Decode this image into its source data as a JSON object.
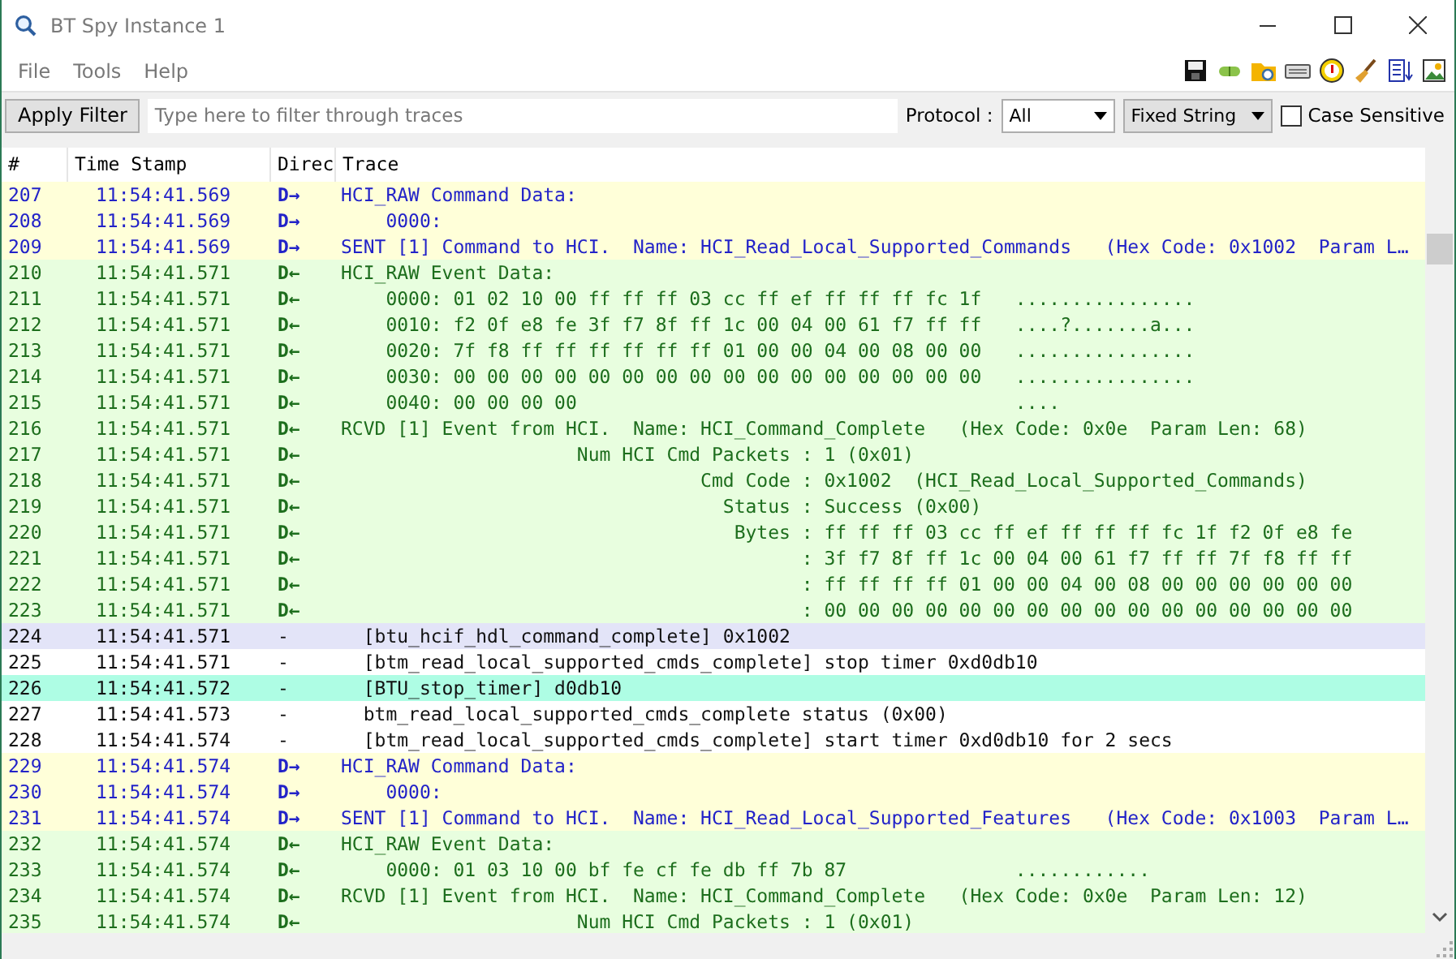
{
  "window": {
    "title": "BT Spy Instance 1"
  },
  "menu": [
    "File",
    "Tools",
    "Help"
  ],
  "filter": {
    "button": "Apply Filter",
    "placeholder": "Type here to filter through traces",
    "protocol_label": "Protocol :",
    "protocol": "All",
    "match_mode": "Fixed String",
    "case_sensitive": {
      "label": "Case Sensitive",
      "checked": false
    }
  },
  "columns": [
    "#",
    "Time Stamp",
    "Direc",
    "Trace"
  ],
  "rows": [
    {
      "kind": "sent",
      "color": "#ffffd9",
      "num": "207",
      "time": "11:54:41.569",
      "dir": "D→",
      "trace": "HCI_RAW Command Data:"
    },
    {
      "kind": "sent",
      "color": "#ffffd9",
      "num": "208",
      "time": "11:54:41.569",
      "dir": "D→",
      "trace": "    0000:"
    },
    {
      "kind": "sent",
      "color": "#ffffd9",
      "num": "209",
      "time": "11:54:41.569",
      "dir": "D→",
      "trace": "SENT [1] Command to HCI.  Name: HCI_Read_Local_Supported_Commands   (Hex Code: 0x1002  Param L…"
    },
    {
      "kind": "rcvd",
      "color": "#e8fedf",
      "num": "210",
      "time": "11:54:41.571",
      "dir": "D←",
      "trace": "HCI_RAW Event Data:"
    },
    {
      "kind": "rcvd",
      "color": "#e8fedf",
      "num": "211",
      "time": "11:54:41.571",
      "dir": "D←",
      "trace": "    0000: 01 02 10 00 ff ff ff 03 cc ff ef ff ff ff fc 1f   ................"
    },
    {
      "kind": "rcvd",
      "color": "#e8fedf",
      "num": "212",
      "time": "11:54:41.571",
      "dir": "D←",
      "trace": "    0010: f2 0f e8 fe 3f f7 8f ff 1c 00 04 00 61 f7 ff ff   ....?.......a..."
    },
    {
      "kind": "rcvd",
      "color": "#e8fedf",
      "num": "213",
      "time": "11:54:41.571",
      "dir": "D←",
      "trace": "    0020: 7f f8 ff ff ff ff ff ff 01 00 00 04 00 08 00 00   ................"
    },
    {
      "kind": "rcvd",
      "color": "#e8fedf",
      "num": "214",
      "time": "11:54:41.571",
      "dir": "D←",
      "trace": "    0030: 00 00 00 00 00 00 00 00 00 00 00 00 00 00 00 00   ................"
    },
    {
      "kind": "rcvd",
      "color": "#e8fedf",
      "num": "215",
      "time": "11:54:41.571",
      "dir": "D←",
      "trace": "    0040: 00 00 00 00                                       ...."
    },
    {
      "kind": "rcvd",
      "color": "#e8fedf",
      "num": "216",
      "time": "11:54:41.571",
      "dir": "D←",
      "trace": "RCVD [1] Event from HCI.  Name: HCI_Command_Complete   (Hex Code: 0x0e  Param Len: 68)"
    },
    {
      "kind": "rcvd",
      "color": "#e8fedf",
      "num": "217",
      "time": "11:54:41.571",
      "dir": "D←",
      "trace": "                     Num HCI Cmd Packets : 1 (0x01)"
    },
    {
      "kind": "rcvd",
      "color": "#e8fedf",
      "num": "218",
      "time": "11:54:41.571",
      "dir": "D←",
      "trace": "                                Cmd Code : 0x1002  (HCI_Read_Local_Supported_Commands)"
    },
    {
      "kind": "rcvd",
      "color": "#e8fedf",
      "num": "219",
      "time": "11:54:41.571",
      "dir": "D←",
      "trace": "                                  Status : Success (0x00)"
    },
    {
      "kind": "rcvd",
      "color": "#e8fedf",
      "num": "220",
      "time": "11:54:41.571",
      "dir": "D←",
      "trace": "                                   Bytes : ff ff ff 03 cc ff ef ff ff ff fc 1f f2 0f e8 fe"
    },
    {
      "kind": "rcvd",
      "color": "#e8fedf",
      "num": "221",
      "time": "11:54:41.571",
      "dir": "D←",
      "trace": "                                         : 3f f7 8f ff 1c 00 04 00 61 f7 ff ff 7f f8 ff ff"
    },
    {
      "kind": "rcvd",
      "color": "#e8fedf",
      "num": "222",
      "time": "11:54:41.571",
      "dir": "D←",
      "trace": "                                         : ff ff ff ff 01 00 00 04 00 08 00 00 00 00 00 00"
    },
    {
      "kind": "rcvd",
      "color": "#e8fedf",
      "num": "223",
      "time": "11:54:41.571",
      "dir": "D←",
      "trace": "                                         : 00 00 00 00 00 00 00 00 00 00 00 00 00 00 00 00"
    },
    {
      "kind": "log",
      "color": "#e3e4f8",
      "num": "224",
      "time": "11:54:41.571",
      "dir": "-",
      "trace": "  [btu_hcif_hdl_command_complete] 0x1002"
    },
    {
      "kind": "log",
      "color": "#ffffff",
      "num": "225",
      "time": "11:54:41.571",
      "dir": "-",
      "trace": "  [btm_read_local_supported_cmds_complete] stop timer 0xd0db10"
    },
    {
      "kind": "log",
      "color": "#aefde4",
      "num": "226",
      "time": "11:54:41.572",
      "dir": "-",
      "trace": "  [BTU_stop_timer] d0db10"
    },
    {
      "kind": "log",
      "color": "#ffffff",
      "num": "227",
      "time": "11:54:41.573",
      "dir": "-",
      "trace": "  btm_read_local_supported_cmds_complete status (0x00)"
    },
    {
      "kind": "log",
      "color": "#ffffff",
      "num": "228",
      "time": "11:54:41.574",
      "dir": "-",
      "trace": "  [btm_read_local_supported_cmds_complete] start timer 0xd0db10 for 2 secs"
    },
    {
      "kind": "sent",
      "color": "#ffffd9",
      "num": "229",
      "time": "11:54:41.574",
      "dir": "D→",
      "trace": "HCI_RAW Command Data:"
    },
    {
      "kind": "sent",
      "color": "#ffffd9",
      "num": "230",
      "time": "11:54:41.574",
      "dir": "D→",
      "trace": "    0000:"
    },
    {
      "kind": "sent",
      "color": "#ffffd9",
      "num": "231",
      "time": "11:54:41.574",
      "dir": "D→",
      "trace": "SENT [1] Command to HCI.  Name: HCI_Read_Local_Supported_Features   (Hex Code: 0x1003  Param L…"
    },
    {
      "kind": "rcvd",
      "color": "#e8fedf",
      "num": "232",
      "time": "11:54:41.574",
      "dir": "D←",
      "trace": "HCI_RAW Event Data:"
    },
    {
      "kind": "rcvd",
      "color": "#e8fedf",
      "num": "233",
      "time": "11:54:41.574",
      "dir": "D←",
      "trace": "    0000: 01 03 10 00 bf fe cf fe db ff 7b 87               ............"
    },
    {
      "kind": "rcvd",
      "color": "#e8fedf",
      "num": "234",
      "time": "11:54:41.574",
      "dir": "D←",
      "trace": "RCVD [1] Event from HCI.  Name: HCI_Command_Complete   (Hex Code: 0x0e  Param Len: 12)"
    },
    {
      "kind": "rcvd",
      "color": "#e8fedf",
      "num": "235",
      "time": "11:54:41.574",
      "dir": "D←",
      "trace": "                     Num HCI Cmd Packets : 1 (0x01)"
    }
  ]
}
